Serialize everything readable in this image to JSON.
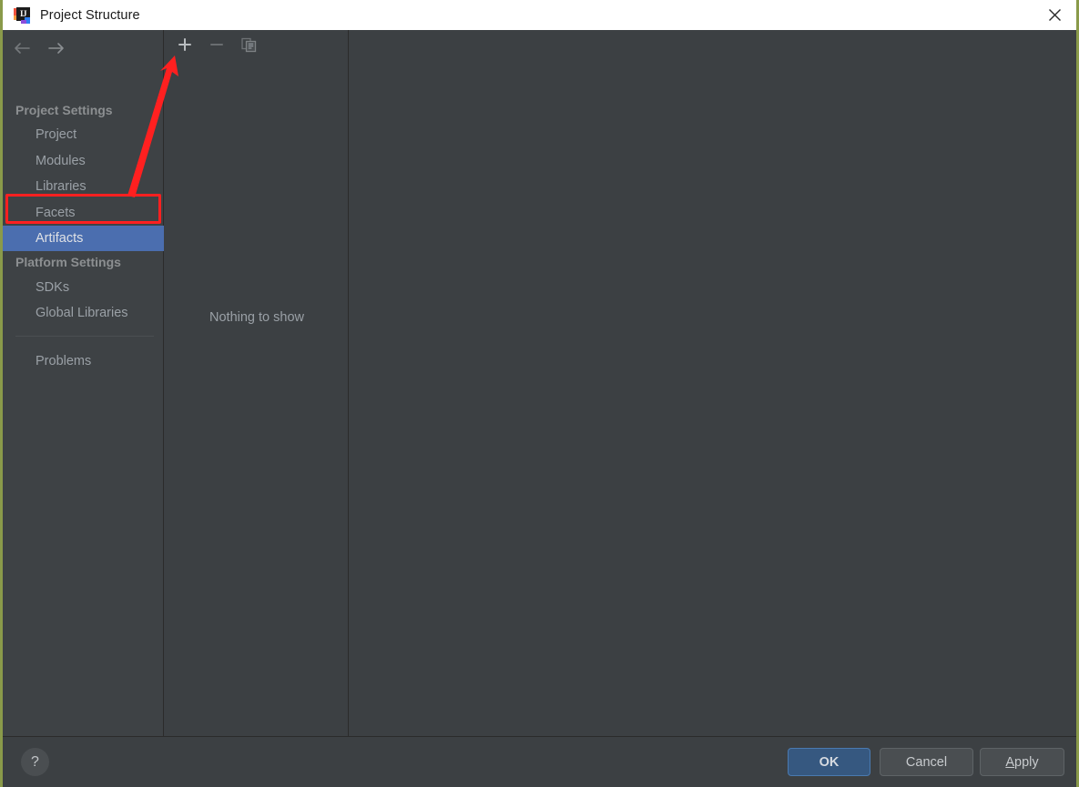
{
  "window": {
    "title": "Project Structure",
    "logo_text": "IJ",
    "close_icon": "close-icon"
  },
  "nav": {
    "back_icon": "arrow-left-icon",
    "forward_icon": "arrow-right-icon"
  },
  "sidebar": {
    "groups": [
      {
        "title": "Project Settings",
        "items": [
          {
            "label": "Project",
            "selected": false
          },
          {
            "label": "Modules",
            "selected": false
          },
          {
            "label": "Libraries",
            "selected": false
          },
          {
            "label": "Facets",
            "selected": false
          },
          {
            "label": "Artifacts",
            "selected": true
          }
        ]
      },
      {
        "title": "Platform Settings",
        "items": [
          {
            "label": "SDKs",
            "selected": false
          },
          {
            "label": "Global Libraries",
            "selected": false
          }
        ]
      }
    ],
    "problems_label": "Problems"
  },
  "toolbar": {
    "add_icon": "plus-icon",
    "remove_icon": "minus-icon",
    "copy_icon": "copy-icon",
    "add_enabled": true,
    "remove_enabled": false,
    "copy_enabled": false
  },
  "middle_panel": {
    "empty_message": "Nothing to show"
  },
  "footer": {
    "help_label": "?",
    "ok_label": "OK",
    "cancel_label": "Cancel",
    "apply_label": "Apply",
    "apply_mnemonic": "A",
    "apply_rest": "pply"
  },
  "annotation": {
    "highlight_target": "Artifacts",
    "arrow_points_to": "plus-icon",
    "color": "#ff2020"
  },
  "colors": {
    "titlebar_bg": "#ffffff",
    "panel_bg": "#3c4043",
    "sidebar_bg": "#3e4245",
    "selection_blue": "#4b6eaf",
    "primary_button": "#365880",
    "window_border": "#8a9a4a",
    "text_muted": "#9aa0a6"
  }
}
